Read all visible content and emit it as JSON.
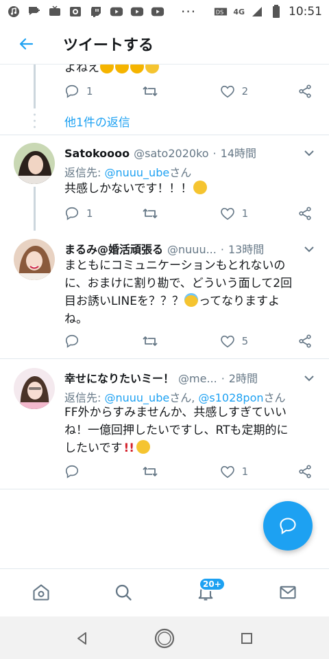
{
  "status_bar": {
    "network": "4G",
    "time": "10:51",
    "overflow": "···"
  },
  "header": {
    "title": "ツイートする"
  },
  "thread": {
    "partial_text": "よねえ",
    "top_actions": {
      "reply_count": "1",
      "retweet_count": "",
      "like_count": "2"
    },
    "more_replies": "他1件の返信"
  },
  "tweets": [
    {
      "name": "Satokoooo",
      "handle": "@sato2020ko",
      "sep": "·",
      "time": "14時間",
      "reply_prefix": "返信先: ",
      "reply_mentions": [
        "@nuuu_ube"
      ],
      "reply_suffix": "さん",
      "text": "共感しかないです！！！",
      "reply_count": "1",
      "like_count": "1"
    },
    {
      "name": "まるみ@婚活頑張る",
      "handle": "@nuuu...",
      "sep": "·",
      "time": "13時間",
      "text_lines": [
        "まともにコミュニケーションもとれないの",
        "に、おまけに割り勘で、どういう面して2回",
        "目お誘いLINEを？？？",
        "ってなりますよ",
        "ね。"
      ],
      "reply_count": "",
      "like_count": "5"
    },
    {
      "name": "幸せになりたいミー！",
      "handle": "@me...",
      "sep": "·",
      "time": "2時間",
      "reply_prefix": "返信先: ",
      "reply_mentions": [
        "@nuuu_ube",
        "@s1028pon"
      ],
      "reply_mid": "さん, ",
      "reply_suffix": "さん",
      "text_lines": [
        "FF外からすみませんか、共感しすぎていい",
        "ね！一億回押したいですし、RTも定期的に",
        "したいです"
      ],
      "reply_count": "",
      "like_count": "1"
    }
  ],
  "tab_bar": {
    "badge": "20+"
  },
  "colors": {
    "accent": "#1da1f2",
    "muted": "#657786",
    "text": "#14171a"
  },
  "icons": [
    "back-arrow-icon",
    "reply-icon",
    "retweet-icon",
    "like-icon",
    "share-icon",
    "chevron-down-icon",
    "compose-icon",
    "home-icon",
    "search-icon",
    "bell-icon",
    "mail-icon"
  ]
}
